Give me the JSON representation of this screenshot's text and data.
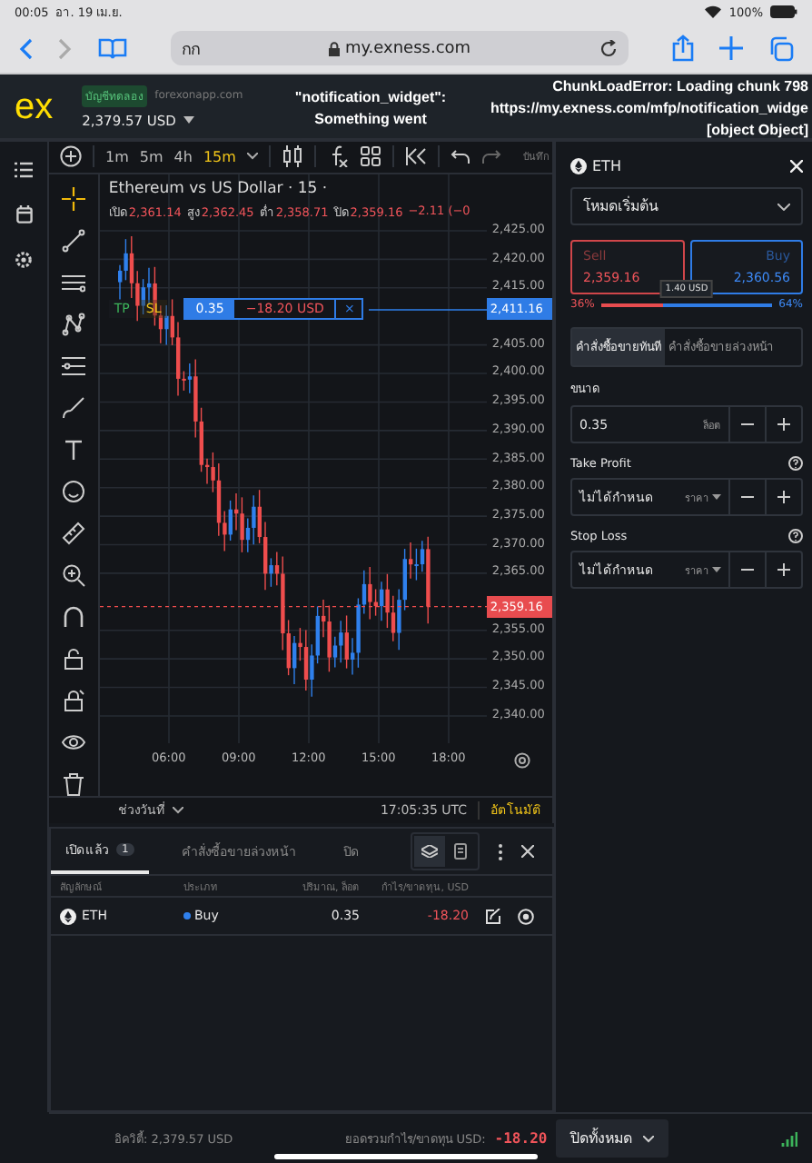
{
  "status_bar": {
    "time": "00:05",
    "date": "อา. 19 เม.ย.",
    "battery": "100%"
  },
  "browser": {
    "text_size_button": "กก",
    "url": "my.exness.com"
  },
  "header": {
    "logo": "ex",
    "account_badge": "บัญชีทดลอง",
    "server": "forexonapp.com",
    "balance": "2,379.57 USD",
    "error_toasts": [
      {
        "lines": [
          "\"notification_widget\":",
          "Something went"
        ]
      },
      {
        "lines": [
          "ChunkLoadError: Loading chunk 798",
          "https://my.exness.com/mfp/notification_widge",
          "[object Object]"
        ]
      }
    ]
  },
  "timeframes": [
    {
      "label": "1m",
      "selected": false
    },
    {
      "label": "5m",
      "selected": false
    },
    {
      "label": "4h",
      "selected": false
    },
    {
      "label": "15m",
      "selected": true
    }
  ],
  "toolbar_save": "บันทึก",
  "chart": {
    "title": "Ethereum vs US Dollar · 15 ·",
    "ohlc": [
      {
        "label": "เปิด",
        "value": "2,361.14"
      },
      {
        "label": "สูง",
        "value": "2,362.45"
      },
      {
        "label": "ต่ำ",
        "value": "2,358.71"
      },
      {
        "label": "ปิด",
        "value": "2,359.16"
      }
    ],
    "change": "−2.11 (−0",
    "position_line": {
      "tp": "TP",
      "sl": "SL",
      "volume": "0.35",
      "pnl": "−18.20 USD",
      "close": "×",
      "price": "2,411.16"
    },
    "current_price": "2,359.16",
    "price_ticks": [
      "2,425.00",
      "2,420.00",
      "2,415.00",
      "2,405.00",
      "2,400.00",
      "2,395.00",
      "2,390.00",
      "2,385.00",
      "2,380.00",
      "2,375.00",
      "2,370.00",
      "2,365.00",
      "2,355.00",
      "2,350.00",
      "2,345.00",
      "2,340.00"
    ],
    "time_ticks": [
      "06:00",
      "09:00",
      "12:00",
      "15:00",
      "18:00"
    ],
    "range_button": "ช่วงวันที่",
    "clock": "17:05:35 UTC",
    "auto_scale": "อัตโนมัติ"
  },
  "order_panel": {
    "symbol": "ETH",
    "mode": "โหมดเริ่มต้น",
    "sell": {
      "label": "Sell",
      "price": "2,359.16"
    },
    "buy": {
      "label": "Buy",
      "price": "2,360.56"
    },
    "spread": "1.40 USD",
    "sentiment": {
      "level": 0.36,
      "sell_share": "36%",
      "buy_share": "64%"
    },
    "order_tabs": [
      {
        "label": "คำสั่งซื้อขายทันที",
        "selected": true
      },
      {
        "label": "คำสั่งซื้อขายล่วงหน้า",
        "selected": false
      }
    ],
    "fields": [
      {
        "label": "ขนาด",
        "value": "0.35",
        "unit": "ล็อต",
        "help": false,
        "dropdown": false
      },
      {
        "label": "Take Profit",
        "value": "ไม่ได้กำหนด",
        "unit": "ราคา",
        "help": true,
        "dropdown": true
      },
      {
        "label": "Stop Loss",
        "value": "ไม่ได้กำหนด",
        "unit": "ราคา",
        "help": true,
        "dropdown": true
      }
    ]
  },
  "positions": {
    "tabs": [
      {
        "label": "เปิดแล้ว",
        "count": "1",
        "selected": true
      },
      {
        "label": "คำสั่งซื้อขายล่วงหน้า",
        "selected": false
      },
      {
        "label": "ปิด",
        "selected": false
      }
    ],
    "view_toggle": [
      {
        "selected": true
      },
      {
        "selected": false
      }
    ],
    "columns": [
      "สัญลักษณ์",
      "ประเภท",
      "ปริมาณ, ล็อต",
      "กำไร/ขาดทุน, USD"
    ],
    "rows": [
      {
        "symbol": "ETH",
        "type": "Buy",
        "volume": "0.35",
        "pnl": "-18.20"
      }
    ]
  },
  "footer": {
    "equity": "อิควิตี้: 2,379.57 USD",
    "total_label": "ยอดรวมกำไร/ขาดทุน USD:",
    "total": "-18.20",
    "close_all": "ปิดทั้งหมด"
  }
}
